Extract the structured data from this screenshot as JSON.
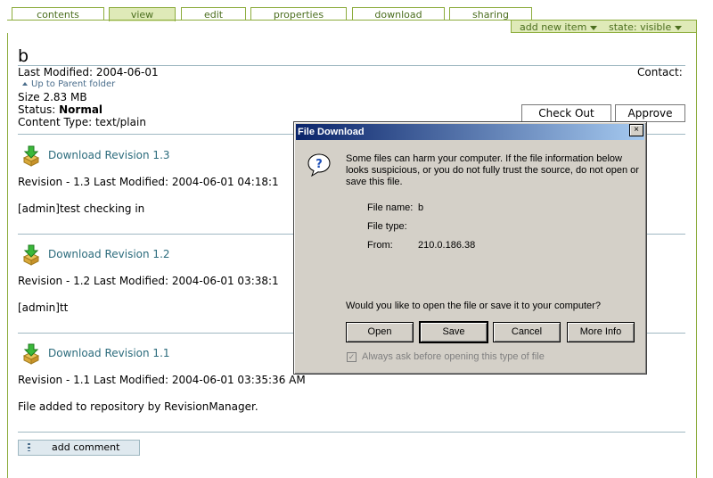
{
  "tabs": {
    "contents": "contents",
    "view": "view",
    "edit": "edit",
    "properties": "properties",
    "download": "download",
    "sharing": "sharing"
  },
  "actions": {
    "add_new_item": "add new item",
    "state": "state: visible"
  },
  "doc": {
    "title": "b",
    "last_modified": "Last Modified: 2004-06-01",
    "contact": "Contact:",
    "up_to_parent": "Up to Parent folder",
    "size": "Size 2.83 MB",
    "status_label": "Status:",
    "status_value": "Normal",
    "content_type": "Content Type: text/plain",
    "check_out": "Check Out",
    "approve": "Approve"
  },
  "revisions": [
    {
      "link": "Download Revision 1.3",
      "info": "Revision - 1.3  Last Modified: 2004-06-01 04:18:1",
      "comment": "[admin]test checking in"
    },
    {
      "link": "Download Revision 1.2",
      "info": "Revision - 1.2  Last Modified: 2004-06-01 03:38:1",
      "comment": "[admin]tt"
    },
    {
      "link": "Download Revision 1.1",
      "info": "Revision - 1.1  Last Modified: 2004-06-01 03:35:36 AM",
      "comment": "File added to repository by RevisionManager."
    }
  ],
  "add_comment": "add comment",
  "dialog": {
    "title": "File Download",
    "close": "×",
    "warning": "Some files can harm your computer. If the file information below looks suspicious, or you do not fully trust the source, do not open or save this file.",
    "file_name_label": "File name:",
    "file_name_value": "b",
    "file_type_label": "File type:",
    "file_type_value": "",
    "from_label": "From:",
    "from_value": "210.0.186.38",
    "question": "Would you like to open the file or save it to your computer?",
    "buttons": {
      "open": "Open",
      "save": "Save",
      "cancel": "Cancel",
      "more_info": "More Info"
    },
    "always_ask": "Always ask before opening this type of file"
  },
  "colors": {
    "tab_border": "#8cac3c",
    "tab_active": "#dfeab8",
    "link": "#2b6b7c",
    "titlebar": "#0a246a",
    "dialog_bg": "#d4d0c8"
  }
}
